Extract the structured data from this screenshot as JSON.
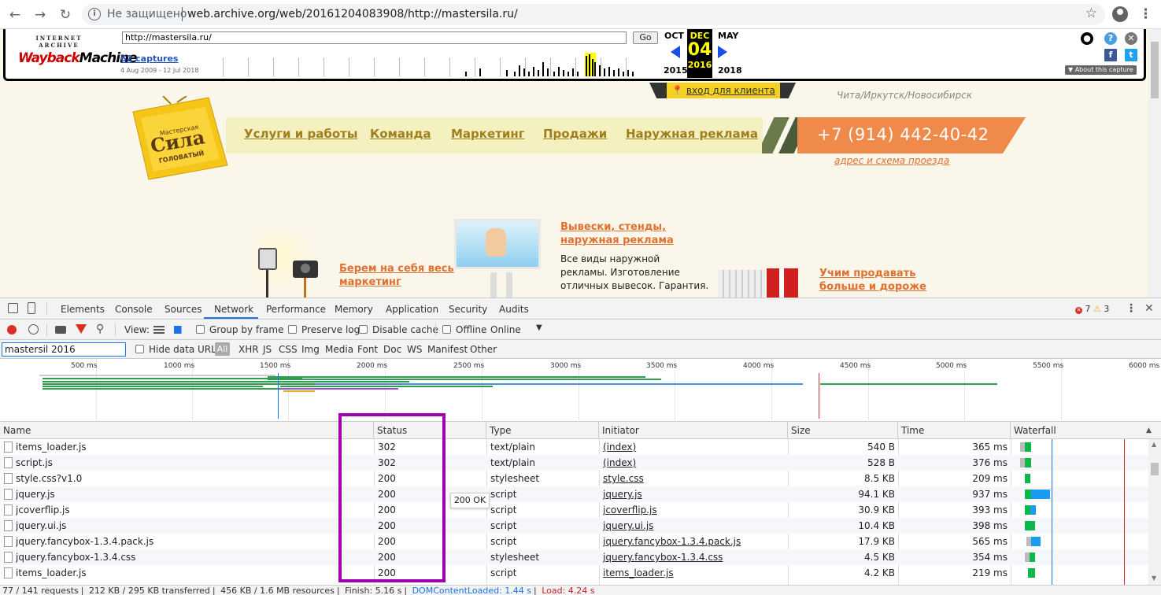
{
  "browser": {
    "security_label": "Не защищено",
    "url": "web.archive.org/web/20161204083908/http://mastersila.ru/"
  },
  "wayback": {
    "logo_top": "INTERNET ARCHIVE",
    "logo_main_a": "Wayback",
    "logo_main_b": "Machine",
    "url_input": "http://mastersila.ru/",
    "go_label": "Go",
    "captures": "62 captures",
    "range": "4 Aug 2009 - 12 Jul 2018",
    "prev_month": "OCT",
    "cur_month": "DEC",
    "next_month": "MAY",
    "cur_day": "04",
    "prev_year": "2015",
    "cur_year": "2016",
    "next_year": "2018",
    "about": "▼ About this capture"
  },
  "site": {
    "login": "вход для клиента",
    "city": "Чита/Иркутск/Новосибирск",
    "logo_small": "Мастерская",
    "logo_big": "Сила",
    "logo_sub": "ГОЛОВАТЫЙ",
    "nav": [
      "Услуги и работы",
      "Команда",
      "Маркетинг",
      "Продажи",
      "Наружная реклама"
    ],
    "phone": "+7 (914) 442-40-42",
    "address": "адрес и схема проезда",
    "promo1_title_1": "Вывески, стенды,",
    "promo1_title_2": "наружная реклама",
    "promo1_text_1": "Все виды наружной",
    "promo1_text_2": "рекламы. Изготовление",
    "promo1_text_3": "отличных вывесок. Гарантия.",
    "promo2_title_1": "Берем на себя весь",
    "promo2_title_2": "маркетинг",
    "promo3_title_1": "Учим продавать",
    "promo3_title_2": "больше и дороже"
  },
  "devtools": {
    "tabs": [
      "Elements",
      "Console",
      "Sources",
      "Network",
      "Performance",
      "Memory",
      "Application",
      "Security",
      "Audits"
    ],
    "errors": "7",
    "warnings": "3",
    "view_label": "View:",
    "group_by_frame": "Group by frame",
    "preserve_log": "Preserve log",
    "disable_cache": "Disable cache",
    "offline": "Offline",
    "throttle": "Online",
    "filter_value": "mastersil 2016",
    "hide_data_urls": "Hide data URLs",
    "types": [
      "All",
      "XHR",
      "JS",
      "CSS",
      "Img",
      "Media",
      "Font",
      "Doc",
      "WS",
      "Manifest",
      "Other"
    ],
    "ticks": [
      "500 ms",
      "1000 ms",
      "1500 ms",
      "2000 ms",
      "2500 ms",
      "3000 ms",
      "3500 ms",
      "4000 ms",
      "4500 ms",
      "5000 ms",
      "5500 ms",
      "6000 ms"
    ],
    "columns": [
      "Name",
      "Status",
      "Type",
      "Initiator",
      "Size",
      "Time",
      "Waterfall"
    ],
    "rows": [
      {
        "name": "items_loader.js",
        "status": "302",
        "type": "text/plain",
        "initiator": "(index)",
        "size": "540 B",
        "time": "365 ms"
      },
      {
        "name": "script.js",
        "status": "302",
        "type": "text/plain",
        "initiator": "(index)",
        "size": "528 B",
        "time": "376 ms"
      },
      {
        "name": "style.css?v1.0",
        "status": "200",
        "type": "stylesheet",
        "initiator": "style.css",
        "size": "8.5 KB",
        "time": "209 ms"
      },
      {
        "name": "jquery.js",
        "status": "200",
        "type": "script",
        "initiator": "jquery.js",
        "size": "94.1 KB",
        "time": "937 ms"
      },
      {
        "name": "jcoverflip.js",
        "status": "200",
        "type": "script",
        "initiator": "jcoverflip.js",
        "size": "30.9 KB",
        "time": "393 ms"
      },
      {
        "name": "jquery.ui.js",
        "status": "200",
        "type": "script",
        "initiator": "jquery.ui.js",
        "size": "10.4 KB",
        "time": "398 ms"
      },
      {
        "name": "jquery.fancybox-1.3.4.pack.js",
        "status": "200",
        "type": "script",
        "initiator": "jquery.fancybox-1.3.4.pack.js",
        "size": "17.9 KB",
        "time": "565 ms"
      },
      {
        "name": "jquery.fancybox-1.3.4.css",
        "status": "200",
        "type": "stylesheet",
        "initiator": "jquery.fancybox-1.3.4.css",
        "size": "4.5 KB",
        "time": "354 ms"
      },
      {
        "name": "items_loader.js",
        "status": "200",
        "type": "script",
        "initiator": "items_loader.js",
        "size": "4.2 KB",
        "time": "219 ms"
      }
    ],
    "tooltip": "200 OK",
    "status": {
      "requests": "77 / 141 requests",
      "transferred": "212 KB / 295 KB transferred",
      "resources": "456 KB / 1.6 MB resources",
      "finish": "Finish: 5.16 s",
      "dcl": "DOMContentLoaded: 1.44 s",
      "load": "Load: 4.24 s"
    }
  }
}
